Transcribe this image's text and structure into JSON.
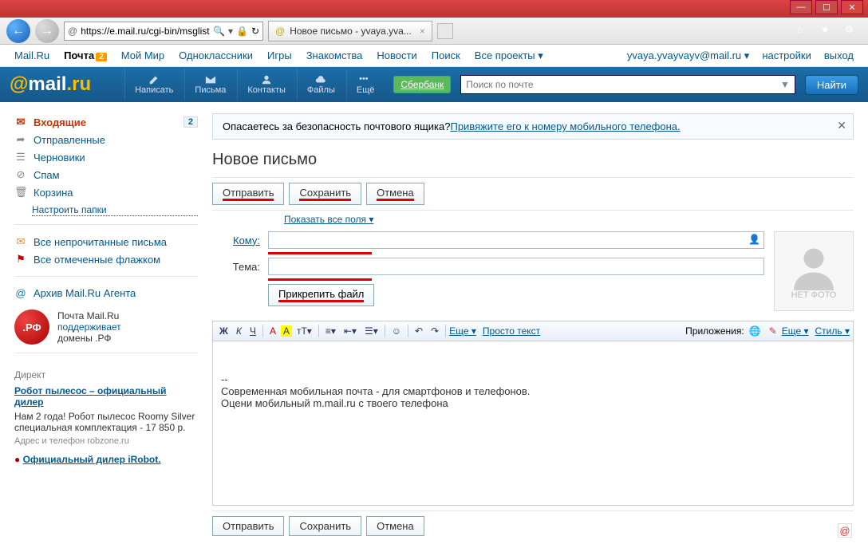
{
  "window": {
    "min": "—",
    "max": "☐",
    "close": "✕"
  },
  "browser": {
    "back": "←",
    "forward": "→",
    "url": "https://e.mail.ru/cgi-bin/msglist?",
    "search_icon": "⌕",
    "lock": "🔒",
    "refresh": "↻",
    "tab_title": "Новое письмо - yvaya.yva...",
    "home": "⌂",
    "star": "★",
    "gear": "⚙"
  },
  "topnav": {
    "items": [
      "Mail.Ru",
      "Почта",
      "Мой Мир",
      "Одноклассники",
      "Игры",
      "Знакомства",
      "Новости",
      "Поиск",
      "Все проекты"
    ],
    "badge": "2",
    "user": "yvaya.yvayvayv@mail.ru",
    "settings": "настройки",
    "exit": "выход"
  },
  "bluebar": {
    "logo_at": "@",
    "logo_mail": "mail",
    "logo_ru": ".ru",
    "compose": "Написать",
    "letters": "Письма",
    "contacts": "Контакты",
    "files": "Файлы",
    "more": "Ещё",
    "sber": "Сбербанк",
    "search_ph": "Поиск по почте",
    "find": "Найти"
  },
  "sidebar": {
    "inbox": "Входящие",
    "inbox_count": "2",
    "sent": "Отправленные",
    "drafts": "Черновики",
    "spam": "Спам",
    "trash": "Корзина",
    "configure": "Настроить папки",
    "unread": "Все непрочитанные письма",
    "flagged": "Все отмеченные флажком",
    "archive": "Архив Mail.Ru Агента",
    "rf_logo": ".РФ",
    "rf_l1": "Почта Mail.Ru",
    "rf_l2": "поддерживает",
    "rf_l3": "домены .РФ",
    "direkt_title": "Директ",
    "ad1_title": "Робот пылесос – официальный дилер",
    "ad1_text": "Нам 2 года! Робот пылесос Roomy Silver специальная комплектация - 17 850 р.",
    "ad1_foot": "Адрес и телефон  robzone.ru",
    "ad2_title": "Официальный дилер iRobot."
  },
  "compose": {
    "alert_text": "Опасаетесь за безопасность почтового ящика? ",
    "alert_link": "Привяжите его к номеру мобильного телефона.",
    "heading": "Новое письмо",
    "send": "Отправить",
    "save": "Сохранить",
    "cancel": "Отмена",
    "show_all": "Показать все поля",
    "to_label": "Кому:",
    "subject_label": "Тема:",
    "attach": "Прикрепить файл",
    "nophoto": "НЕТ ФОТО",
    "editor": {
      "bold": "Ж",
      "italic": "К",
      "underline": "Ч",
      "more": "Еще",
      "plain": "Просто текст",
      "apps": "Приложения:",
      "more2": "Еще",
      "style": "Стиль"
    },
    "body_prefix": "--",
    "body_l1": "Современная мобильная почта - для смартфонов и телефонов.",
    "body_l2": "Оцени мобильный m.mail.ru с твоего телефона"
  }
}
